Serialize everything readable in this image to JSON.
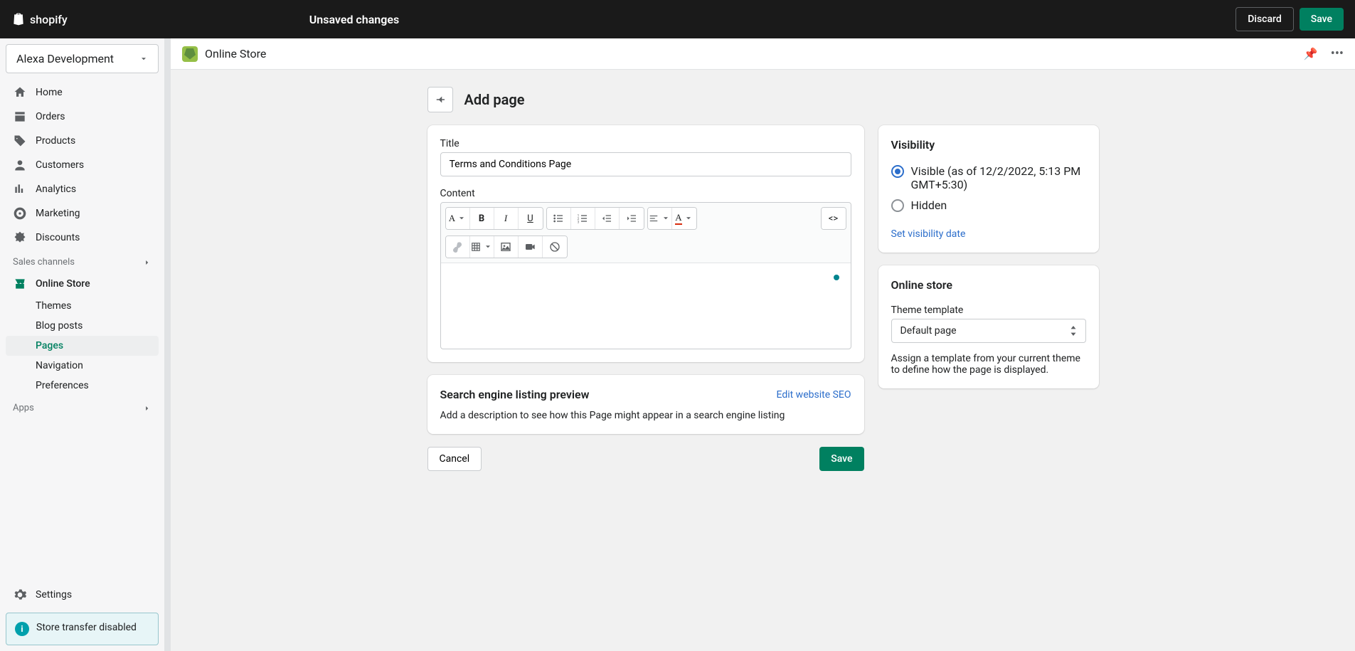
{
  "topbar": {
    "logo_text": "shopify",
    "unsaved": "Unsaved changes",
    "discard": "Discard",
    "save": "Save"
  },
  "store_name": "Alexa Development",
  "nav": {
    "home": "Home",
    "orders": "Orders",
    "products": "Products",
    "customers": "Customers",
    "analytics": "Analytics",
    "marketing": "Marketing",
    "discounts": "Discounts"
  },
  "sales_channels_label": "Sales channels",
  "online_store": {
    "label": "Online Store",
    "sub": {
      "themes": "Themes",
      "blog_posts": "Blog posts",
      "pages": "Pages",
      "navigation": "Navigation",
      "preferences": "Preferences"
    }
  },
  "apps_label": "Apps",
  "settings_label": "Settings",
  "transfer_notice": "Store transfer disabled",
  "contextbar": {
    "title": "Online Store"
  },
  "page": {
    "title": "Add page",
    "form": {
      "title_label": "Title",
      "title_value": "Terms and Conditions Page",
      "content_label": "Content"
    },
    "seo": {
      "heading": "Search engine listing preview",
      "edit_link": "Edit website SEO",
      "help": "Add a description to see how this Page might appear in a search engine listing"
    },
    "visibility": {
      "heading": "Visibility",
      "visible_label": "Visible (as of 12/2/2022, 5:13 PM GMT+5:30)",
      "hidden_label": "Hidden",
      "set_date": "Set visibility date"
    },
    "online_store_card": {
      "heading": "Online store",
      "template_label": "Theme template",
      "template_value": "Default page",
      "help": "Assign a template from your current theme to define how the page is displayed."
    },
    "cancel": "Cancel",
    "save": "Save"
  },
  "rte_icons": {
    "format": "A",
    "bold": "B",
    "italic": "I",
    "underline": "U",
    "code": "<>"
  }
}
